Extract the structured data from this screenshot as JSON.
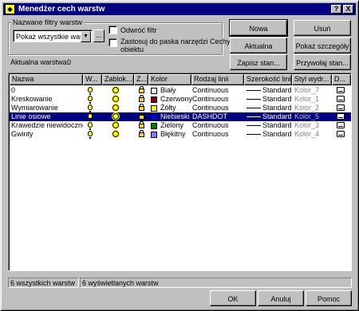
{
  "window": {
    "title": "Menedżer cech warstw",
    "help_label": "?",
    "close_label": "X"
  },
  "filter": {
    "group_label": "Nazwane filtry warstw",
    "select_value": "Pokaż wszystkie warst",
    "browse_label": "...",
    "invert_label": "Odwróć filtr",
    "apply_toolbar_label_1": "Zastosuj do paska narzędzi Cechy",
    "apply_toolbar_label_2": "obiektu"
  },
  "current_layer": {
    "label": "Aktualna warstwa:",
    "value": "0"
  },
  "buttons": {
    "new": "Nowa",
    "delete": "Usuń",
    "current": "Aktualna",
    "show_details": "Pokaż szczegóły",
    "save_state": "Zapisz stan...",
    "restore_state": "Przywołaj stan...",
    "ok": "OK",
    "cancel": "Anuluj",
    "help": "Pomoc"
  },
  "columns": {
    "name": "Nazwa",
    "on": "W...",
    "frozen": "Zablok...",
    "lock": "Z...",
    "color": "Kolor",
    "linetype": "Rodzaj linii",
    "lineweight": "Szerokość linii",
    "plot_style": "Styl wydr...",
    "plot": "D..."
  },
  "layers": [
    {
      "name": "0",
      "color_name": "Biały",
      "color_hex": "#ffffff",
      "linetype": "Continuous",
      "lineweight": "Standard",
      "plot_style": "Kolor_7",
      "selected": false
    },
    {
      "name": "Kreskowanie",
      "color_name": "Czerwony",
      "color_hex": "#800000",
      "linetype": "Continuous",
      "lineweight": "Standard",
      "plot_style": "Kolor_1",
      "selected": false
    },
    {
      "name": "Wymiarowanie",
      "color_name": "Żółty",
      "color_hex": "#ffff00",
      "linetype": "Continuous",
      "lineweight": "Standard",
      "plot_style": "Kolor_2",
      "selected": false
    },
    {
      "name": "Linie osiowe",
      "color_name": "Niebieski",
      "color_hex": "#0000ff",
      "linetype": "DASHDOT",
      "lineweight": "Standard",
      "plot_style": "Kolor_5",
      "selected": true
    },
    {
      "name": "Krawedzie niewidoczne",
      "color_name": "Zielony",
      "color_hex": "#008000",
      "linetype": "Continuous",
      "lineweight": "Standard",
      "plot_style": "Kolor_3",
      "selected": false
    },
    {
      "name": "Gwinty",
      "color_name": "Błękitny",
      "color_hex": "#8080ff",
      "linetype": "Continuous",
      "lineweight": "Standard",
      "plot_style": "Kolor_4",
      "selected": false
    }
  ],
  "status": {
    "total": "6 wszystkich warstw",
    "shown": "6 wyświetlanych warstw"
  }
}
